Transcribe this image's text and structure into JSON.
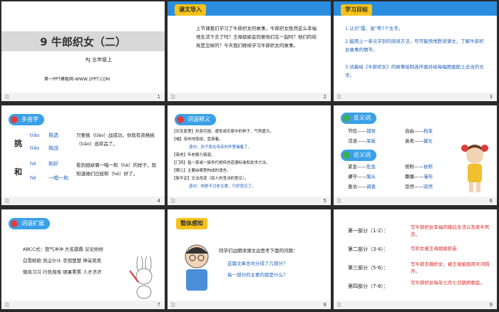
{
  "s1": {
    "title": "9 牛郎织女（二）",
    "sub": "RJ  五年级上",
    "url": "第一PPT模板网-WWW.1PPT.COM",
    "left": "治",
    "num": "1"
  },
  "s2": {
    "tag": "课文导入",
    "text": "上节课我们学习了牛郎织女的故事，牛郎织女既然这么幸福地生活下去了吗？王母娘娘会同意他们在一起吗？他们的结局是怎样的？今天我们继续学习牛郎织女的故事。",
    "left": "治",
    "num": "2"
  },
  "s3": {
    "tag": "学习目标",
    "items": [
      "1.认识\"霞、衰\"等7个生字。",
      "2.能用上一单元学到的阅读方法，尽可能快地默读课文，了解牛郎织女故事的情节。",
      "3.试着给《牛郎织女》的故事绘制连环画并给每幅图画配上适当的文字。"
    ],
    "left": "治",
    "num": "3"
  },
  "s4": {
    "tag": "多音字",
    "char1": "挑",
    "r1a": "tiāo",
    "w1a": "挑选",
    "r1b": "tiǎo",
    "w1b": "挑战",
    "t1": "只要挑（tiǎo）战成功，你就有资格挑（tiāo）选奖品了。",
    "char2": "和",
    "r2a": "hé",
    "w2a": "和好",
    "r2b": "hè",
    "w2b": "一唱一和",
    "t2": "看到姐妹俩一唱一和（hè）的样子，就知道她们已经和（hé）好了。",
    "left": "治",
    "num": "4"
  },
  "s5": {
    "tag": "词语释义",
    "items": [
      "【穷苦家里】形容穷困、遭贫或穷家中的样子、气势盛大。",
      "【哺】亲热地靠拢，宣扬着。",
      "造句：孩子靠在母亲的怀里哺着了。",
      "【衰老】年老精力衰退。",
      "【门风】指一家或一族世代相传的道德标准和处世方法。",
      "【哪儿】主要由哪里构成的语言。",
      "【絮不定】无法改变（别人的坚决的意见）。",
      "造句：他绝不过老太婆，只好答应了。"
    ],
    "left": "治",
    "num": "5"
  },
  "s6": {
    "tag1": "反义词",
    "ant": [
      [
        "节俭",
        "铺张"
      ],
      [
        "自由",
        "拘束"
      ],
      [
        "活泼",
        "呆板"
      ],
      [
        "衰老",
        "健壮"
      ]
    ],
    "tag2": "近义词",
    "syn": [
      [
        "紧急",
        "危急"
      ],
      [
        "按照",
        "依照"
      ],
      [
        "遵守",
        "服从"
      ],
      [
        "撒播",
        "漫布"
      ],
      [
        "查访",
        "调查"
      ],
      [
        "忽然",
        "突然"
      ]
    ],
    "left": "治",
    "num": "6"
  },
  "s7": {
    "tag": "词语扩展",
    "lines": [
      "ABCC式：怒气冲冲 大名鼎鼎 议论纷纷",
      "白雪皑皑 风尘仆仆 衣冠楚楚 神采奕奕",
      "微风习习 行色匆匆 硕果累累 人才济济"
    ],
    "left": "治",
    "num": "7"
  },
  "s8": {
    "tag": "整体感知",
    "q1": "同学们边朗读课文边思考下面的问题：",
    "q2": "这篇文章总共分成了几部分？",
    "q3": "每一部分的主要内容是什么？",
    "left": "治",
    "num": "8"
  },
  "s9": {
    "parts": [
      {
        "p": "第一部分（1-2）：",
        "d": "写牛郎织女幸福的婚后生活以及老牛死去。"
      },
      {
        "p": "第二部分（3-4）：",
        "d": "写织女被王母娘娘抓走"
      },
      {
        "p": "第三部分（5-6）：",
        "d": "写牛郎去救织女，被王母娘娘用天河隔开。"
      },
      {
        "p": "第四部分（7-8）：",
        "d": "写牛郎织女每年七月七日鹊桥相会。"
      }
    ],
    "left": "治",
    "num": "9"
  },
  "colors": {
    "accent": "#2a8de0",
    "tag": "#f5c31a",
    "red": "#d22222"
  }
}
